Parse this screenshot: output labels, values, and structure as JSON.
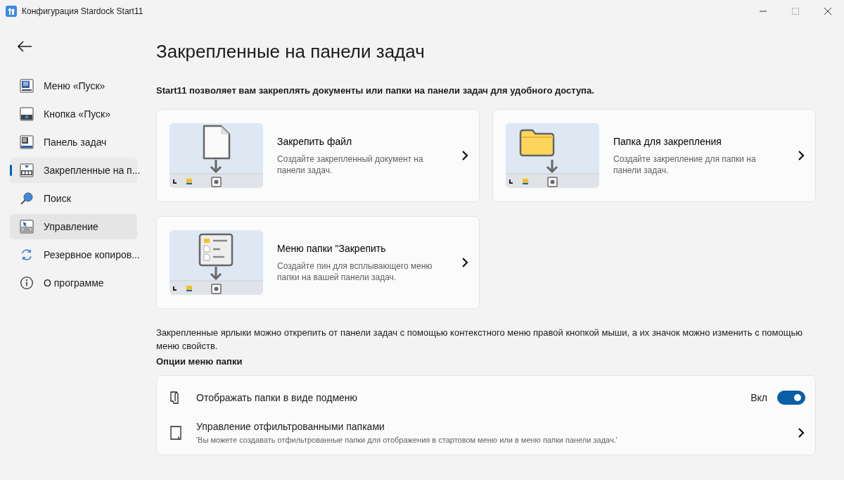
{
  "window": {
    "title": "Конфигурация Stardock Start11"
  },
  "sidebar": {
    "items": [
      {
        "label": "Меню «Пуск»",
        "selected": false,
        "hovered": false
      },
      {
        "label": "Кнопка «Пуск»",
        "selected": false,
        "hovered": false
      },
      {
        "label": "Панель задач",
        "selected": false,
        "hovered": false
      },
      {
        "label": "Закрепленные на п...",
        "selected": true,
        "hovered": false
      },
      {
        "label": "Поиск",
        "selected": false,
        "hovered": false
      },
      {
        "label": "Управление",
        "selected": false,
        "hovered": true
      },
      {
        "label": "Резервное копиров...",
        "selected": false,
        "hovered": false
      },
      {
        "label": "О программе",
        "selected": false,
        "hovered": false
      }
    ]
  },
  "page": {
    "title": "Закрепленные на панели задач",
    "intro": "Start11 позволяет вам закреплять документы или папки на панели задач для удобного доступа.",
    "cards": [
      {
        "kind": "file",
        "title": "Закрепить файл",
        "description": "Создайте закрепленный документ на панели задач."
      },
      {
        "kind": "folder",
        "title": "Папка для закрепления",
        "description": "Создайте закрепление для папки на панели задач."
      },
      {
        "kind": "menu",
        "title": "Меню папки \"Закрепить",
        "description": "Создайте пин для всплывающего меню папки на вашей панели задач."
      }
    ],
    "note": "Закрепленные ярлыки можно открепить от панели задач с помощью контекстного меню правой кнопкой мыши, а их значок можно изменить с помощью меню свойств.",
    "options_heading": "Опции меню папки",
    "options": [
      {
        "kind": "toggle",
        "title": "Отображать папки в виде подменю",
        "state_label": "Вкл",
        "on": true
      },
      {
        "kind": "link",
        "title": "Управление отфильтрованными папками",
        "description": "'Вы можете создавать отфильтрованные папки для отображения в стартовом меню или в меню папки панели задач.'"
      }
    ]
  }
}
